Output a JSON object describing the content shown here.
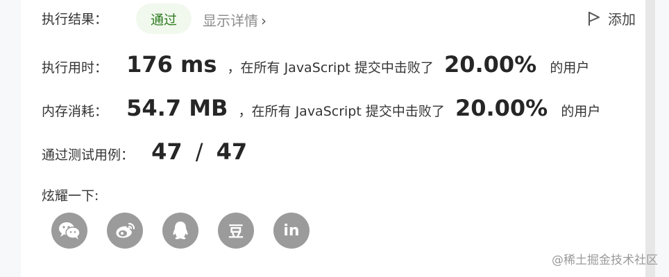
{
  "result": {
    "label": "执行结果：",
    "status": "通过",
    "detail_link": "显示详情",
    "detail_chevron": "›",
    "add_label": "添加"
  },
  "runtime": {
    "label": "执行用时：",
    "value": "176 ms",
    "text_before": "，在所有 JavaScript 提交中击败了",
    "percent": "20.00%",
    "text_after": "的用户"
  },
  "memory": {
    "label": "内存消耗：",
    "value": "54.7 MB",
    "text_before": "，在所有 JavaScript 提交中击败了",
    "percent": "20.00%",
    "text_after": "的用户"
  },
  "tests": {
    "label": "通过测试用例：",
    "passed": "47",
    "sep": "/",
    "total": "47"
  },
  "share": {
    "label": "炫耀一下:",
    "icons": [
      "wechat-icon",
      "weibo-icon",
      "qq-icon",
      "douban-icon",
      "linkedin-icon"
    ],
    "douban_glyph": "豆",
    "linkedin_glyph": "in"
  },
  "watermark": "@稀土掘金技术社区",
  "colors": {
    "pass_bg": "#f1f9ee",
    "pass_text": "#2d7a1f",
    "icon_bg": "#9b9b9b"
  }
}
